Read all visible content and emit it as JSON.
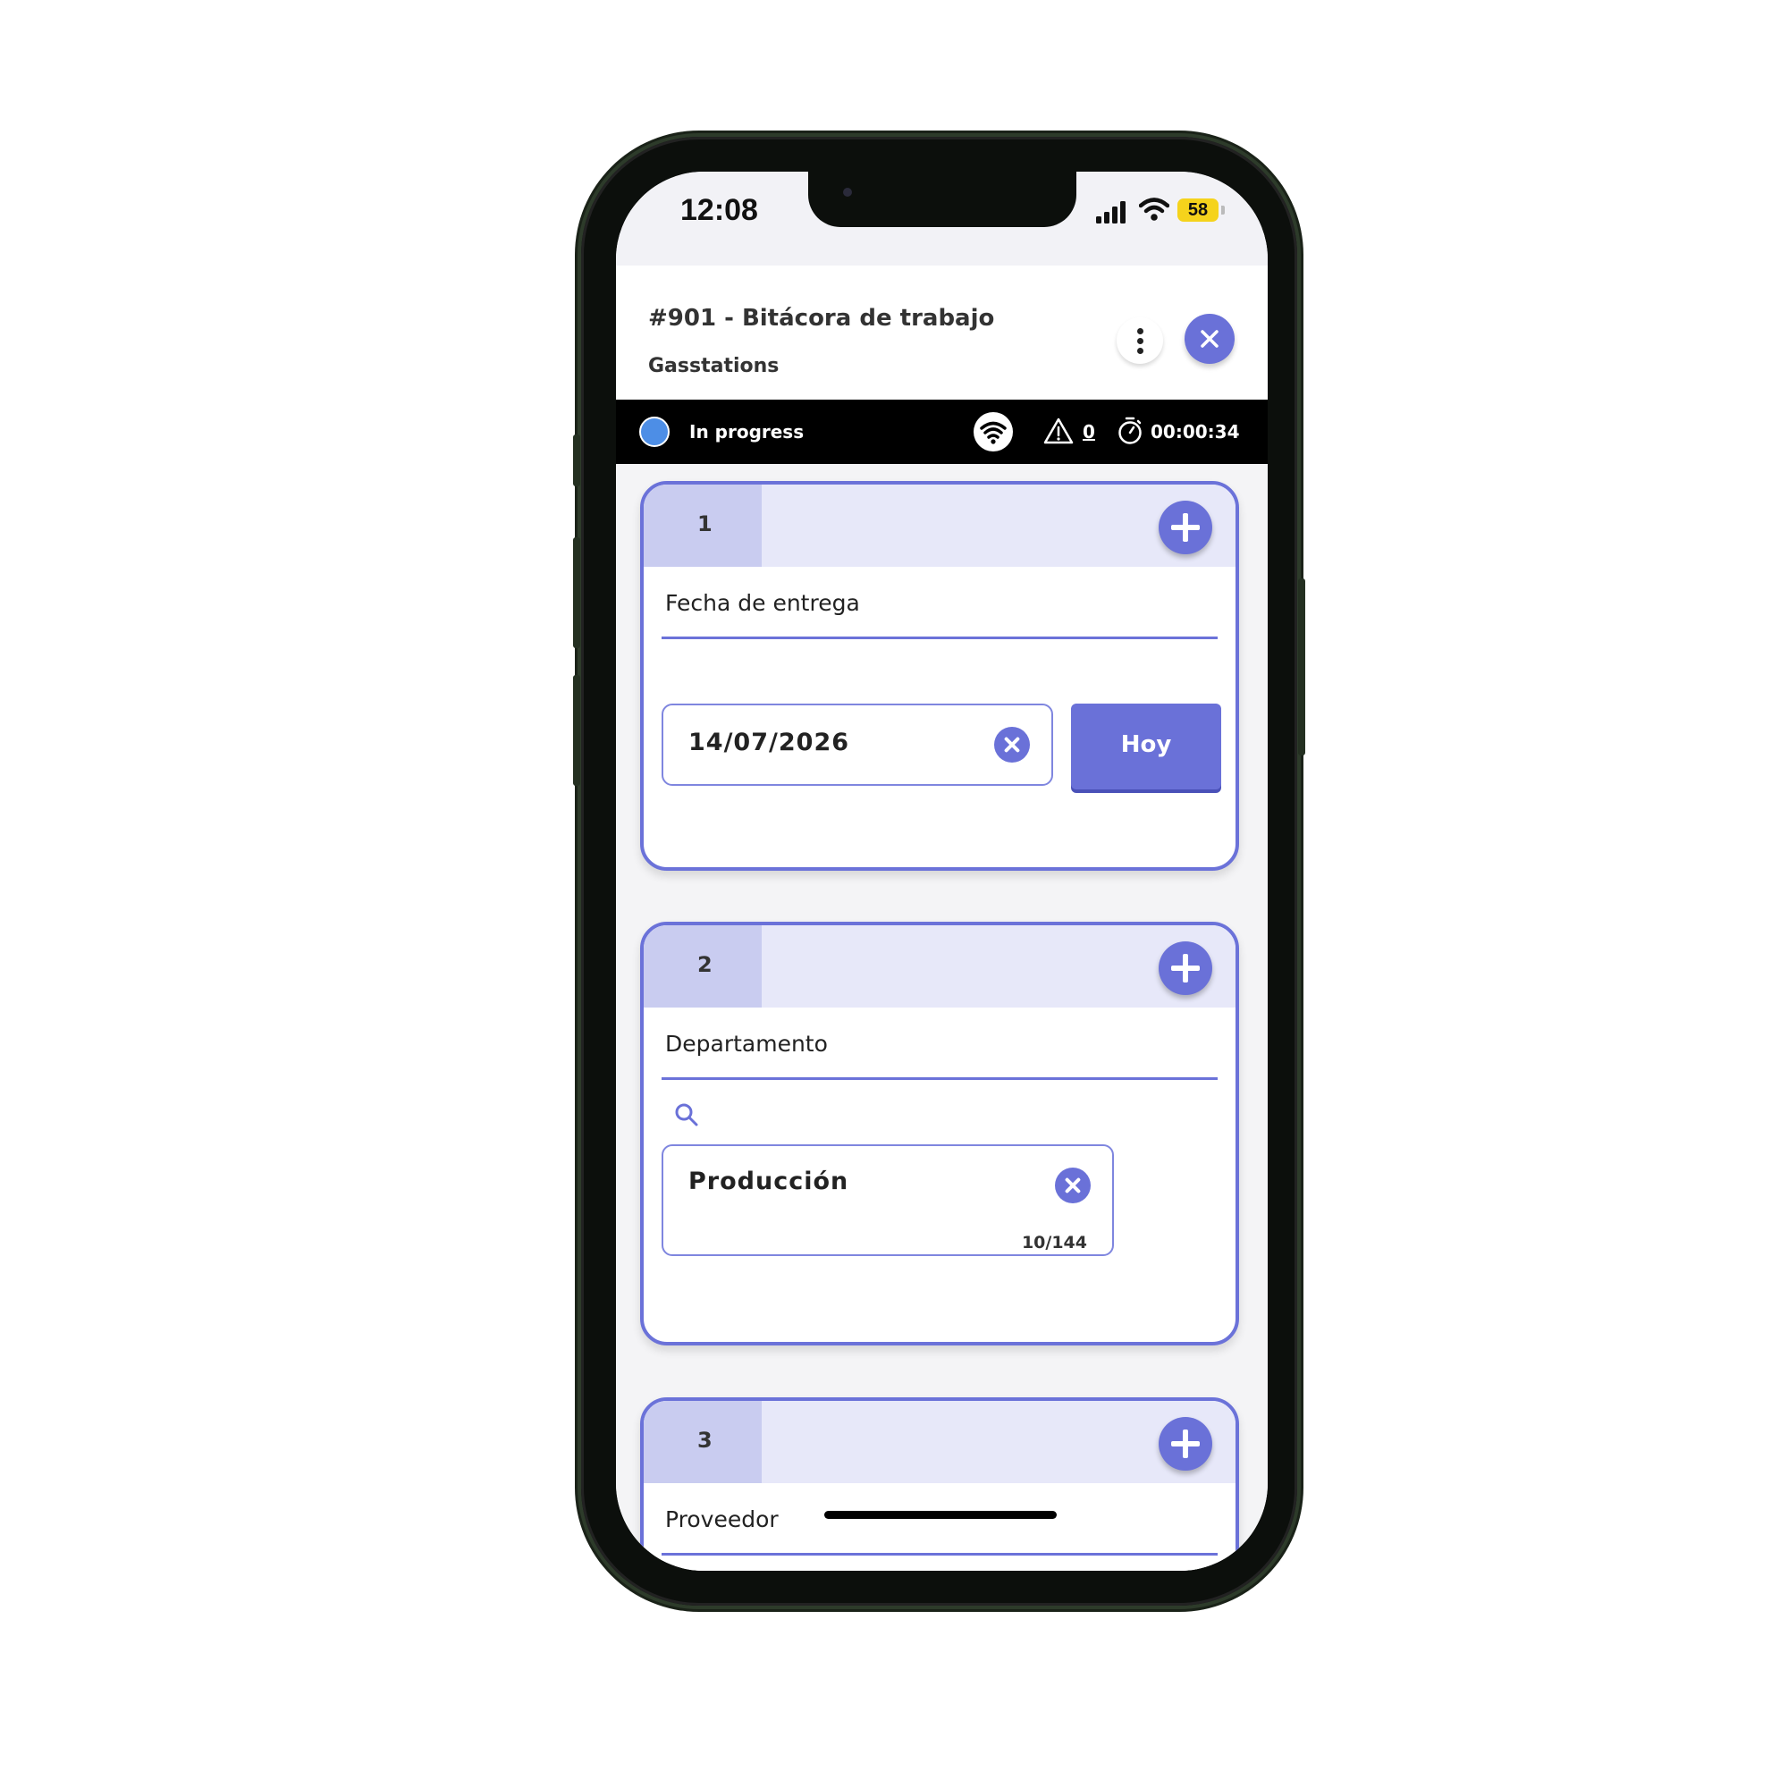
{
  "status_bar": {
    "time": "12:08",
    "battery": "58",
    "battery_color": "#f5d31c"
  },
  "header": {
    "title": "#901 - Bitácora de trabajo",
    "subtitle": "Gasstations",
    "menu_icon": "kebab-icon",
    "close_icon": "close-icon"
  },
  "status": {
    "label": "In progress",
    "dot_color": "#4d8ee6",
    "warnings": "0",
    "timer": "00:00:34"
  },
  "cards": [
    {
      "number": "1",
      "label": "Fecha de entrega",
      "date_value": "14/07/2026",
      "today_button": "Hoy"
    },
    {
      "number": "2",
      "label": "Departamento",
      "selected": "Producción",
      "count": "10/144"
    },
    {
      "number": "3",
      "label": "Proveedor"
    }
  ],
  "accent_color": "#6a71d8"
}
